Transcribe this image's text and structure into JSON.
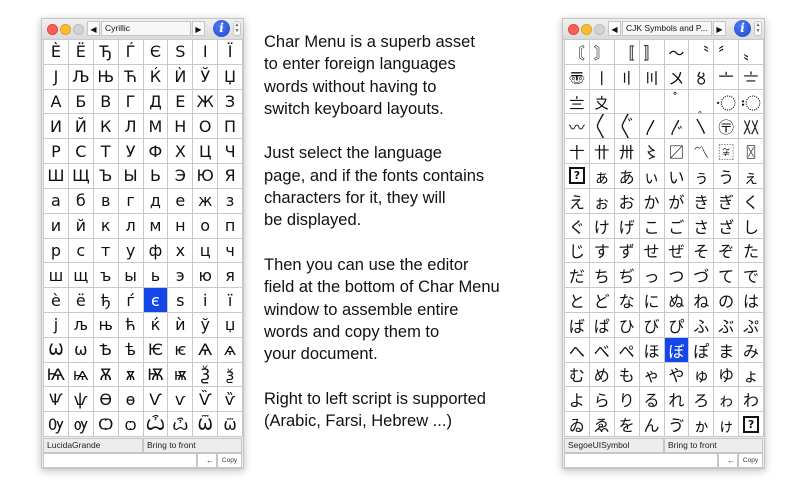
{
  "left_window": {
    "page": "Cyrillic",
    "font": "LucidaGrande",
    "bring_to_front": "Bring to front",
    "copy": "Copy",
    "back": "←",
    "editor_value": "",
    "selected": "є",
    "rows": [
      [
        "È",
        "Ë",
        "Ђ",
        "Ѓ",
        "Є",
        "Ѕ",
        "І",
        "Ї"
      ],
      [
        "Ј",
        "Љ",
        "Њ",
        "Ћ",
        "Ќ",
        "Ѝ",
        "Ў",
        "Џ"
      ],
      [
        "А",
        "Б",
        "В",
        "Г",
        "Д",
        "Е",
        "Ж",
        "З"
      ],
      [
        "И",
        "Й",
        "К",
        "Л",
        "М",
        "Н",
        "О",
        "П"
      ],
      [
        "Р",
        "С",
        "Т",
        "У",
        "Ф",
        "Х",
        "Ц",
        "Ч"
      ],
      [
        "Ш",
        "Щ",
        "Ъ",
        "Ы",
        "Ь",
        "Э",
        "Ю",
        "Я"
      ],
      [
        "а",
        "б",
        "в",
        "г",
        "д",
        "е",
        "ж",
        "з"
      ],
      [
        "и",
        "й",
        "к",
        "л",
        "м",
        "н",
        "о",
        "п"
      ],
      [
        "р",
        "с",
        "т",
        "у",
        "ф",
        "х",
        "ц",
        "ч"
      ],
      [
        "ш",
        "щ",
        "ъ",
        "ы",
        "ь",
        "э",
        "ю",
        "я"
      ],
      [
        "è",
        "ё",
        "ђ",
        "ѓ",
        "є",
        "ѕ",
        "і",
        "ї"
      ],
      [
        "ј",
        "љ",
        "њ",
        "ћ",
        "ќ",
        "ѝ",
        "ў",
        "џ"
      ],
      [
        "Ѡ",
        "ѡ",
        "Ѣ",
        "ѣ",
        "Ѥ",
        "ѥ",
        "Ѧ",
        "ѧ"
      ],
      [
        "Ѩ",
        "ѩ",
        "Ѫ",
        "ѫ",
        "Ѭ",
        "ѭ",
        "Ѯ",
        "ѯ"
      ],
      [
        "Ѱ",
        "ѱ",
        "Ѳ",
        "ѳ",
        "Ѵ",
        "ѵ",
        "Ѷ",
        "ѷ"
      ],
      [
        "Ѹ",
        "ѹ",
        "Ѻ",
        "ѻ",
        "Ѽ",
        "ѽ",
        "Ѿ",
        "ѿ"
      ]
    ]
  },
  "right_window": {
    "page": "CJK Symbols and P...",
    "font": "SegoeUISymbol",
    "bring_to_front": "Bring to front",
    "copy": "Copy",
    "back": "←",
    "editor_value": "",
    "selected": "ぼ",
    "rows": [
      [
        "〘",
        "〙",
        "〚",
        "〛",
        "〜",
        "〝",
        "〞",
        "〟"
      ],
      [
        "〠",
        "〡",
        "〢",
        "〣",
        "〤",
        "〥",
        "〦",
        "〧"
      ],
      [
        "〨",
        "〩",
        "〪",
        "〫",
        "〬",
        "〭",
        "〮",
        "〯"
      ],
      [
        "〰",
        "〱",
        "〲",
        "〳",
        "〴",
        "〵",
        "〶",
        "〷"
      ],
      [
        "〸",
        "〹",
        "〺",
        "〻",
        "〼",
        "〽",
        "〾",
        "〿"
      ],
      [
        "?",
        "ぁ",
        "あ",
        "ぃ",
        "い",
        "ぅ",
        "う",
        "ぇ"
      ],
      [
        "え",
        "ぉ",
        "お",
        "か",
        "が",
        "き",
        "ぎ",
        "く"
      ],
      [
        "ぐ",
        "け",
        "げ",
        "こ",
        "ご",
        "さ",
        "ざ",
        "し"
      ],
      [
        "じ",
        "す",
        "ず",
        "せ",
        "ぜ",
        "そ",
        "ぞ",
        "た"
      ],
      [
        "だ",
        "ち",
        "ぢ",
        "っ",
        "つ",
        "づ",
        "て",
        "で"
      ],
      [
        "と",
        "ど",
        "な",
        "に",
        "ぬ",
        "ね",
        "の",
        "は"
      ],
      [
        "ば",
        "ぱ",
        "ひ",
        "び",
        "ぴ",
        "ふ",
        "ぶ",
        "ぷ"
      ],
      [
        "へ",
        "べ",
        "ぺ",
        "ほ",
        "ぼ",
        "ぽ",
        "ま",
        "み"
      ],
      [
        "む",
        "め",
        "も",
        "ゃ",
        "や",
        "ゅ",
        "ゆ",
        "ょ"
      ],
      [
        "よ",
        "ら",
        "り",
        "る",
        "れ",
        "ろ",
        "ゎ",
        "わ"
      ],
      [
        "ゐ",
        "ゑ",
        "を",
        "ん",
        "ゔ",
        "ゕ",
        "ゖ",
        "?"
      ]
    ]
  },
  "description": {
    "paragraphs": [
      "Char Menu is a superb asset\nto enter foreign languages\nwords without having to\nswitch keyboard layouts.",
      "Just select the language\npage, and if the fonts contains\ncharacters for it, they will\nbe displayed.",
      "Then you can use the editor\nfield at the bottom of Char Menu\nwindow to assemble entire\nwords and copy them to\nyour document.",
      "Right to left script is supported\n(Arabic, Farsi, Hebrew ...)"
    ]
  },
  "icons": {
    "prev": "◀",
    "next": "▶",
    "info": "i",
    "stepper": "⌃⌄",
    "clear": "×"
  }
}
